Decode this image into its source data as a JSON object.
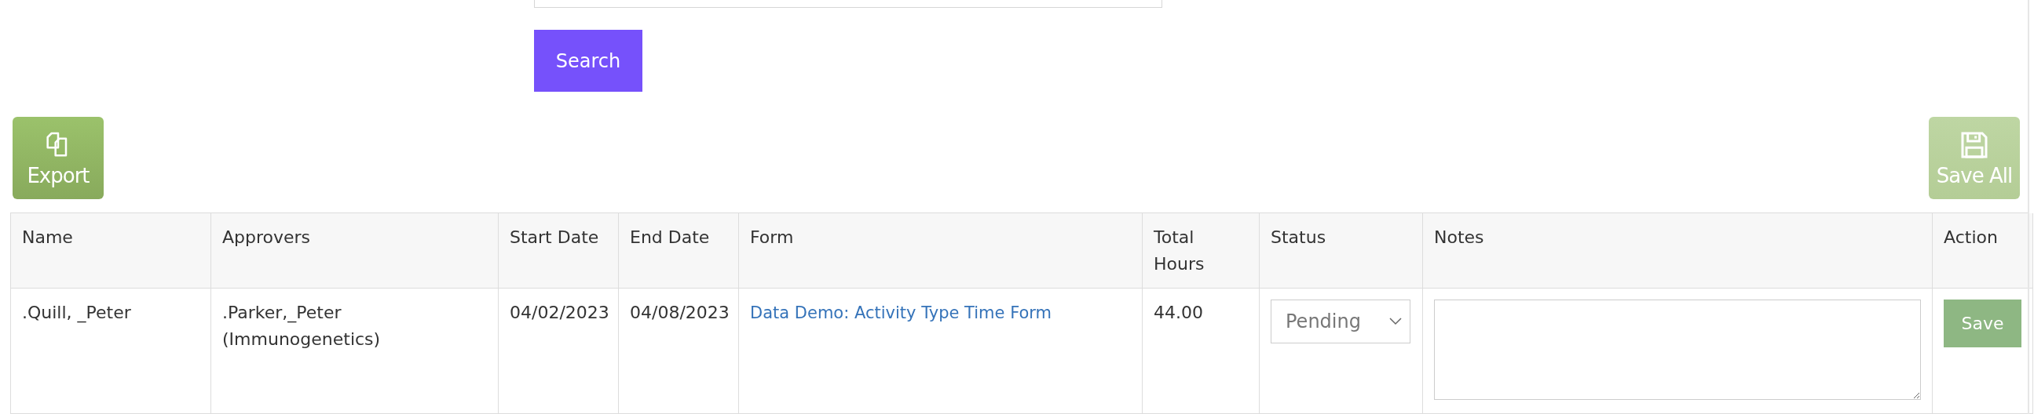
{
  "search": {
    "button": "Search"
  },
  "toolbar": {
    "export": {
      "label": "Export",
      "disabled": false
    },
    "save_all": {
      "label": "Save All",
      "disabled": true
    }
  },
  "table": {
    "columns": [
      "Name",
      "Approvers",
      "Start Date",
      "End Date",
      "Form",
      "Total Hours",
      "Status",
      "Notes",
      "Action"
    ],
    "rows": [
      {
        "name": ".Quill, _Peter",
        "approvers": ".Parker,_Peter (Immunogenetics)",
        "start_date": "04/02/2023",
        "end_date": "04/08/2023",
        "form": "Data Demo: Activity Type Time Form",
        "total_hours": "44.00",
        "status": "Pending",
        "action": "Save"
      }
    ]
  }
}
